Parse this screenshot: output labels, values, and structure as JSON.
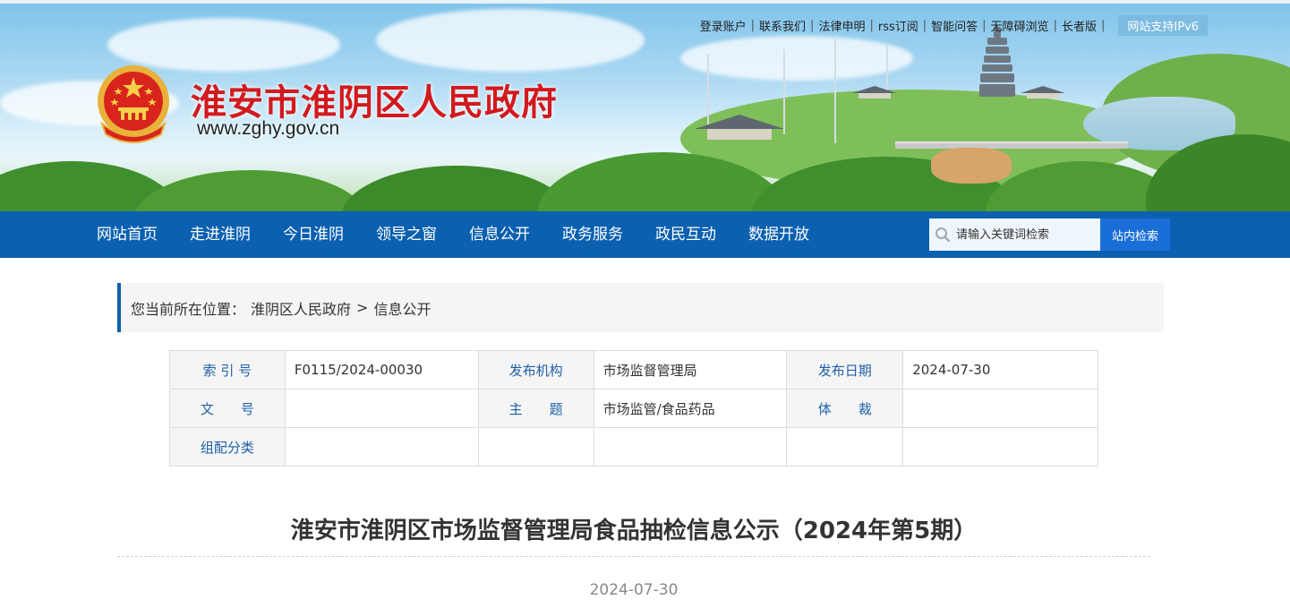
{
  "header": {
    "site_title": "淮安市淮阴区人民政府",
    "site_url": "www.zghy.gov.cn",
    "top_links": [
      "登录账户",
      "联系我们",
      "法律申明",
      "rss订阅",
      "智能问答",
      "无障碍浏览",
      "长者版"
    ],
    "ipv6_badge": "网站支持IPv6"
  },
  "nav": {
    "items": [
      "网站首页",
      "走进淮阴",
      "今日淮阴",
      "领导之窗",
      "信息公开",
      "政务服务",
      "政民互动",
      "数据开放"
    ],
    "search": {
      "placeholder": "请输入关键词检索",
      "button_label": "站内检索",
      "icon": "search-icon"
    }
  },
  "breadcrumb": {
    "prefix": "您当前所在位置：",
    "items": [
      "淮阴区人民政府",
      "信息公开"
    ],
    "separator": ">"
  },
  "info_table": {
    "rows": [
      [
        {
          "label": "索 引 号",
          "value": "F0115/2024-00030"
        },
        {
          "label": "发布机构",
          "value": "市场监督管理局"
        },
        {
          "label": "发布日期",
          "value": "2024-07-30"
        }
      ],
      [
        {
          "label": "文　　号",
          "value": ""
        },
        {
          "label": "主　　题",
          "value": "市场监管/食品药品"
        },
        {
          "label": "体　　裁",
          "value": ""
        }
      ],
      [
        {
          "label": "组配分类",
          "value": ""
        },
        {
          "label": "",
          "value": ""
        },
        {
          "label": "",
          "value": ""
        }
      ]
    ]
  },
  "article": {
    "title": "淮安市淮阴区市场监督管理局食品抽检信息公示（2024年第5期）",
    "date": "2024-07-30"
  },
  "colors": {
    "nav_bg": "#0b60b0",
    "title_red": "#d11a1f",
    "label_blue": "#1d5fa8",
    "search_button": "#1a6ed8",
    "ipv6_badge": "#7dbbe2"
  }
}
